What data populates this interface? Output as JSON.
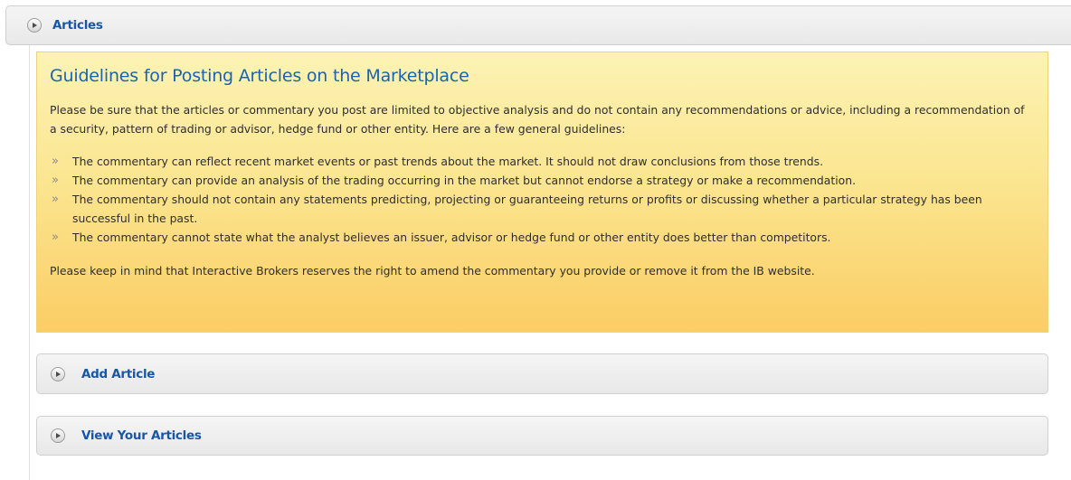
{
  "articles_section": {
    "label": "Articles",
    "icon": "play-icon"
  },
  "guidelines": {
    "title": "Guidelines for Posting Articles on the Marketplace",
    "intro": "Please be sure that the articles or commentary you post are limited to objective analysis and do not contain any recommendations or advice, including a recommendation of a security, pattern of trading or advisor, hedge fund or other entity. Here are a few general guidelines:",
    "rules": [
      "The commentary can reflect recent market events or past trends about the market. It should not draw conclusions from those trends.",
      "The commentary can provide an analysis of the trading occurring in the market but cannot endorse a strategy or make a recommendation.",
      "The commentary should not contain any statements predicting, projecting or guaranteeing returns or profits or discussing whether a particular strategy has been successful in the past.",
      "The commentary cannot state what the analyst believes an issuer, advisor or hedge fund or other entity does better than competitors."
    ],
    "outro": "Please keep in mind that Interactive Brokers reserves the right to amend the commentary you provide or remove it from the IB website.",
    "colors": {
      "title": "#1b63b0",
      "box_top": "#fcf3b4",
      "box_bottom": "#fbcd65"
    }
  },
  "add_article": {
    "label": "Add Article",
    "icon": "play-icon"
  },
  "view_articles": {
    "label": "View Your Articles",
    "icon": "play-icon"
  },
  "colors": {
    "link": "#1a56a6"
  }
}
